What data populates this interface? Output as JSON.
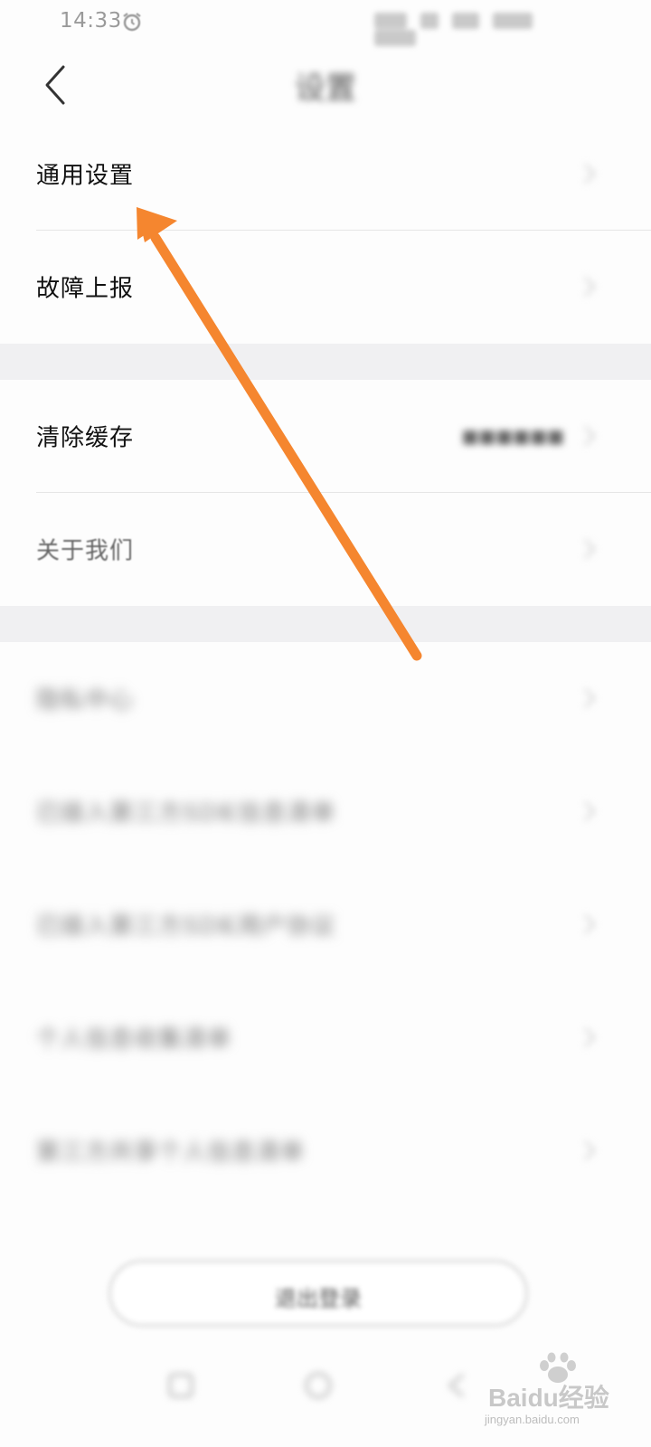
{
  "status_bar": {
    "time": "14:33",
    "icons": [
      "alarm-icon",
      "signal-icon",
      "wifi-icon",
      "battery-icon"
    ]
  },
  "header": {
    "title": "设置",
    "back_icon": "chevron-left-icon"
  },
  "sections": [
    {
      "items": [
        {
          "label": "通用设置",
          "chevron": "chevron-right-icon"
        },
        {
          "label": "故障上报",
          "chevron": "chevron-right-icon"
        }
      ]
    },
    {
      "items": [
        {
          "label": "清除缓存",
          "chevron": "chevron-right-icon"
        },
        {
          "label": "关于我们",
          "chevron": "chevron-right-icon"
        }
      ]
    },
    {
      "items": [
        {
          "label": "隐私中心",
          "chevron": "chevron-right-icon"
        },
        {
          "label": "已接入第三方SDK信息清单",
          "chevron": "chevron-right-icon"
        },
        {
          "label": "已接入第三方SDK用户协议",
          "chevron": "chevron-right-icon"
        },
        {
          "label": "个人信息收集清单",
          "chevron": "chevron-right-icon"
        },
        {
          "label": "第三方共享个人信息清单",
          "chevron": "chevron-right-icon"
        }
      ]
    }
  ],
  "logout_button": {
    "label": "退出登录"
  },
  "annotation": {
    "arrow_color": "#f5862f",
    "points_to": "通用设置"
  },
  "watermark": {
    "brand": "Baidu经验",
    "url": "jingyan.baidu.com"
  },
  "colors": {
    "background": "#fdfdfd",
    "section_gap": "#f0f0f2",
    "divider": "#e6e6e6",
    "text_primary": "#111111",
    "arrow": "#f5862f"
  }
}
